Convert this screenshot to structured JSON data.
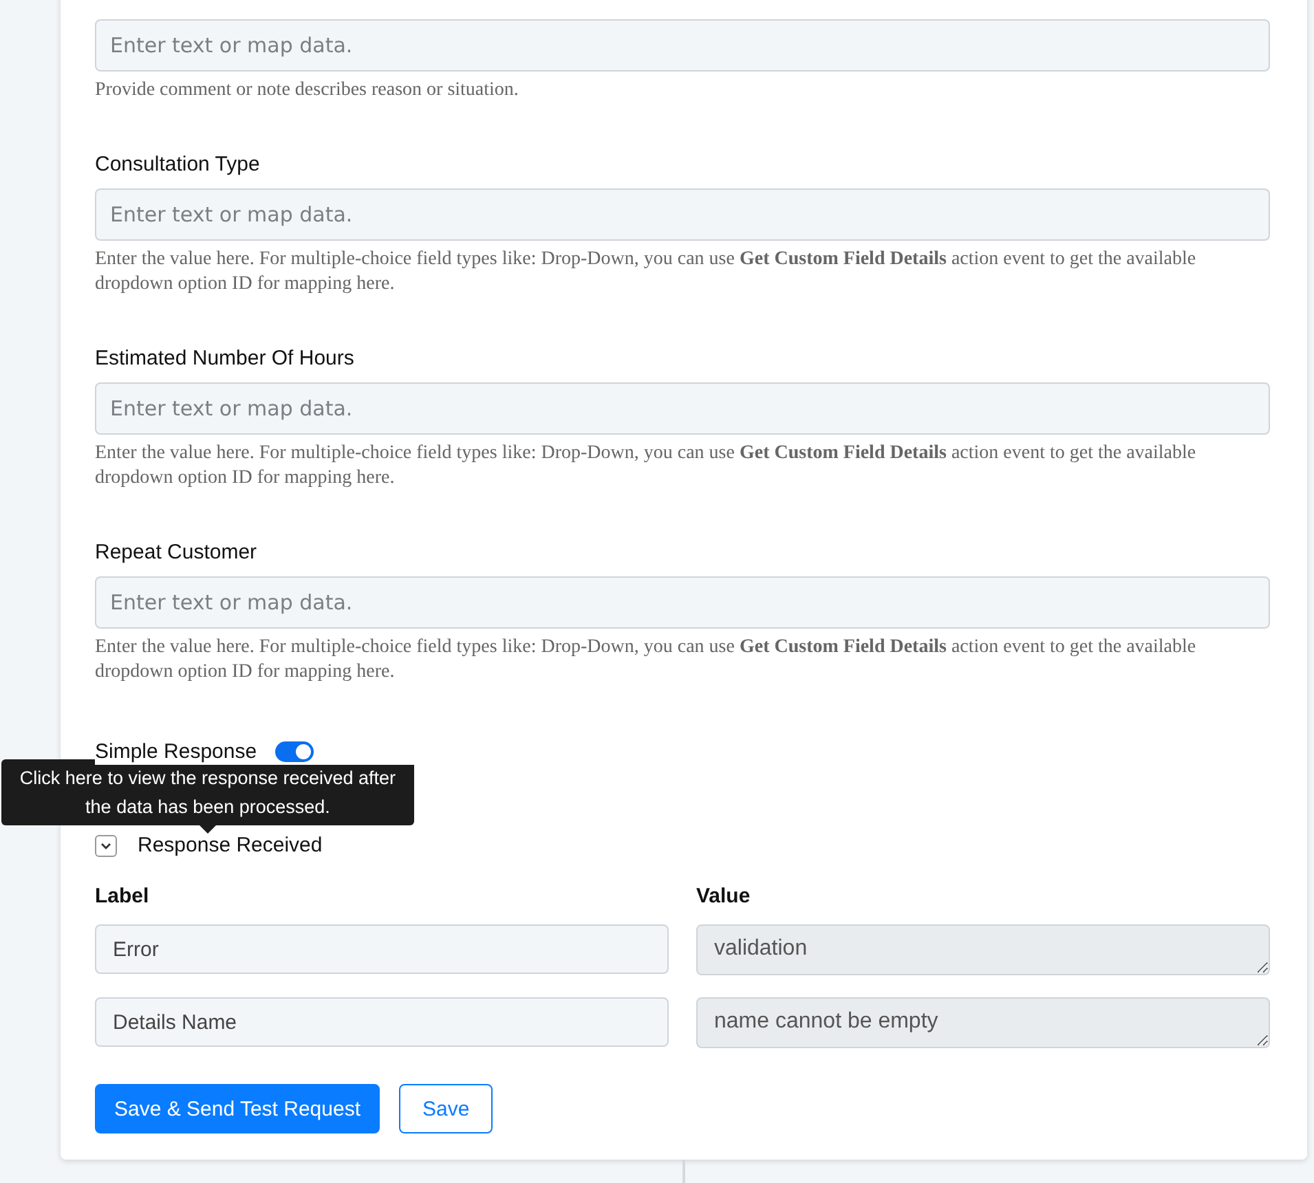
{
  "fields": [
    {
      "placeholder": "Enter text or map data.",
      "help": "Provide comment or note describes reason or situation."
    },
    {
      "label": "Consultation Type",
      "placeholder": "Enter text or map data.",
      "help": "Enter the value here. For multiple-choice field types like: Drop-Down, you can use **Get Custom Field Details** action event to get the available dropdown option ID for mapping here."
    },
    {
      "label": "Estimated Number Of Hours",
      "placeholder": "Enter text or map data.",
      "help": "Enter the value here. For multiple-choice field types like: Drop-Down, you can use **Get Custom Field Details** action event to get the available dropdown option ID for mapping here."
    },
    {
      "label": "Repeat Customer",
      "placeholder": "Enter text or map data.",
      "help": "Enter the value here. For multiple-choice field types like: Drop-Down, you can use **Get Custom Field Details** action event to get the available dropdown option ID for mapping here."
    }
  ],
  "simple_response": {
    "label": "Simple Response",
    "on": true
  },
  "tooltip": "Click here to view the response received after the data has been processed.",
  "response": {
    "label": "Response Received",
    "expanded": true,
    "columns": [
      "Label",
      "Value"
    ],
    "rows": [
      {
        "label": "Error",
        "value": "validation"
      },
      {
        "label": "Details Name",
        "value": "name cannot be empty"
      }
    ]
  },
  "buttons": [
    {
      "label": "Save & Send Test Request",
      "kind": "primary"
    },
    {
      "label": "Save",
      "kind": "outline"
    }
  ]
}
